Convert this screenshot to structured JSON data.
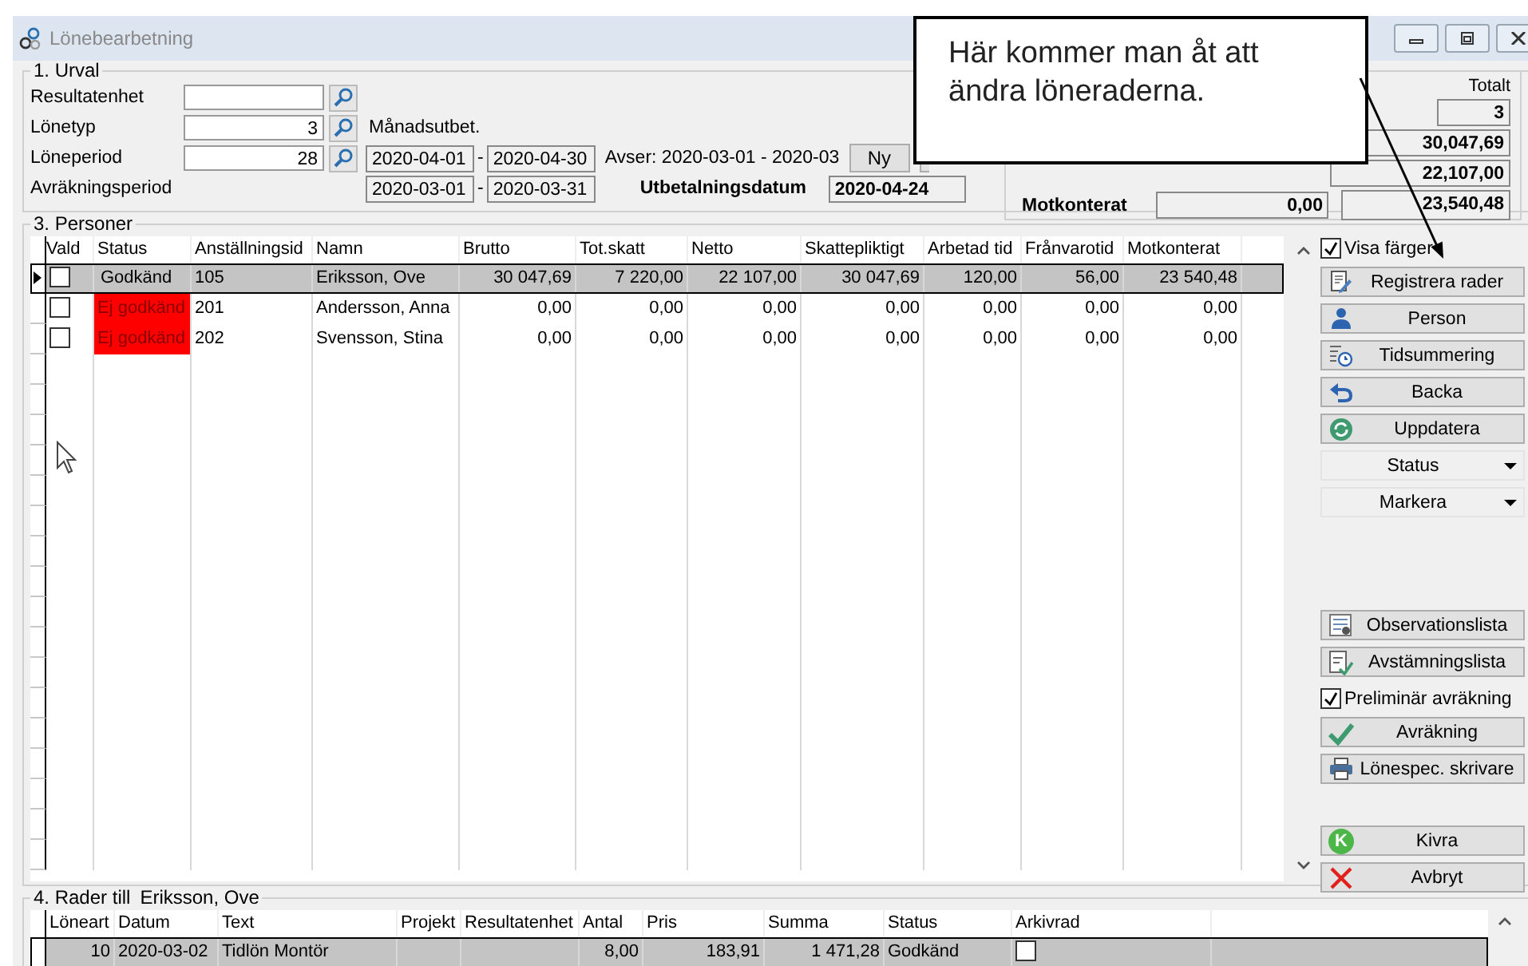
{
  "window": {
    "title": "Lönebearbetning"
  },
  "selection": {
    "legend": "1. Urval",
    "resultatenhet": {
      "label": "Resultatenhet"
    },
    "lonetyp": {
      "label": "Lönetyp",
      "value": "3",
      "description": "Månadsutbet."
    },
    "loneperiod": {
      "label": "Löneperiod",
      "value": "28",
      "from": "2020-04-01",
      "dash": "-",
      "to": "2020-04-30",
      "avser": "Avser: 2020-03-01 - 2020-03",
      "new_button": "Ny"
    },
    "avrakningsperiod": {
      "label": "Avräkningsperiod",
      "from": "2020-03-01",
      "dash": "-",
      "to": "2020-03-31"
    },
    "payout": {
      "label": "Utbetalningsdatum",
      "value": "2020-04-24"
    }
  },
  "totals": {
    "heading": "Totalt",
    "count": "3",
    "values": [
      "30,047,69",
      "22,107,00"
    ],
    "motkonterat": {
      "label": "Motkonterat",
      "value": "0,00",
      "total": "23,540,48"
    }
  },
  "persons": {
    "legend": "3. Personer",
    "check_column": "Vald",
    "columns": [
      "Status",
      "Anställningsid",
      "Namn",
      "Brutto",
      "Tot.skatt",
      "Netto",
      "Skattepliktigt",
      "Arbetad tid",
      "Frånvarotid",
      "Motkonterat"
    ],
    "rows": [
      {
        "selected": true,
        "checked": false,
        "approved": true,
        "cells": [
          "Godkänd",
          "105",
          "Eriksson, Ove",
          "30 047,69",
          "7 220,00",
          "22 107,00",
          "30 047,69",
          "120,00",
          "56,00",
          "23 540,48"
        ]
      },
      {
        "selected": false,
        "checked": false,
        "approved": false,
        "cells": [
          "Ej godkänd",
          "201",
          "Andersson, Anna",
          "0,00",
          "0,00",
          "0,00",
          "0,00",
          "0,00",
          "0,00",
          "0,00"
        ]
      },
      {
        "selected": false,
        "checked": false,
        "approved": false,
        "cells": [
          "Ej godkänd",
          "202",
          "Svensson, Stina",
          "0,00",
          "0,00",
          "0,00",
          "0,00",
          "0,00",
          "0,00",
          "0,00"
        ]
      }
    ]
  },
  "panel": {
    "groups": [
      [
        {
          "kind": "checkbox",
          "label": "Visa färger",
          "checked": true
        },
        {
          "kind": "button",
          "label": "Registrera rader"
        },
        {
          "kind": "button",
          "label": "Person"
        },
        {
          "kind": "button",
          "label": "Tidsummering"
        },
        {
          "kind": "button",
          "label": "Backa"
        },
        {
          "kind": "button",
          "label": "Uppdatera"
        },
        {
          "kind": "dropdown",
          "label": "Status"
        },
        {
          "kind": "dropdown",
          "label": "Markera"
        }
      ],
      [
        {
          "kind": "button",
          "label": "Observationslista"
        },
        {
          "kind": "button",
          "label": "Avstämningslista"
        },
        {
          "kind": "checkbox",
          "label": "Preliminär avräkning",
          "checked": true
        },
        {
          "kind": "button",
          "label": "Avräkning"
        },
        {
          "kind": "button",
          "label": "Lönespec. skrivare"
        }
      ],
      [
        {
          "kind": "button",
          "label": "Kivra",
          "badge": "K"
        },
        {
          "kind": "button",
          "label": "Avbryt"
        }
      ]
    ]
  },
  "detail": {
    "legend": "4. Rader till",
    "person": "Eriksson, Ove",
    "columns": [
      "Löneart",
      "Datum",
      "Text",
      "Projekt",
      "Resultatenhet",
      "Antal",
      "Pris",
      "Summa",
      "Status",
      "Arkivrad"
    ],
    "rows": [
      {
        "selected": true,
        "archived": false,
        "cells": {
          "0": "10",
          "1": "2020-03-02",
          "2": "Tidlön Montör",
          "5": "8,00",
          "6": "183,91",
          "7": "1 471,28",
          "8": "Godkänd"
        }
      }
    ]
  },
  "callout": {
    "text": "Här kommer man åt att ändra löneraderna."
  }
}
